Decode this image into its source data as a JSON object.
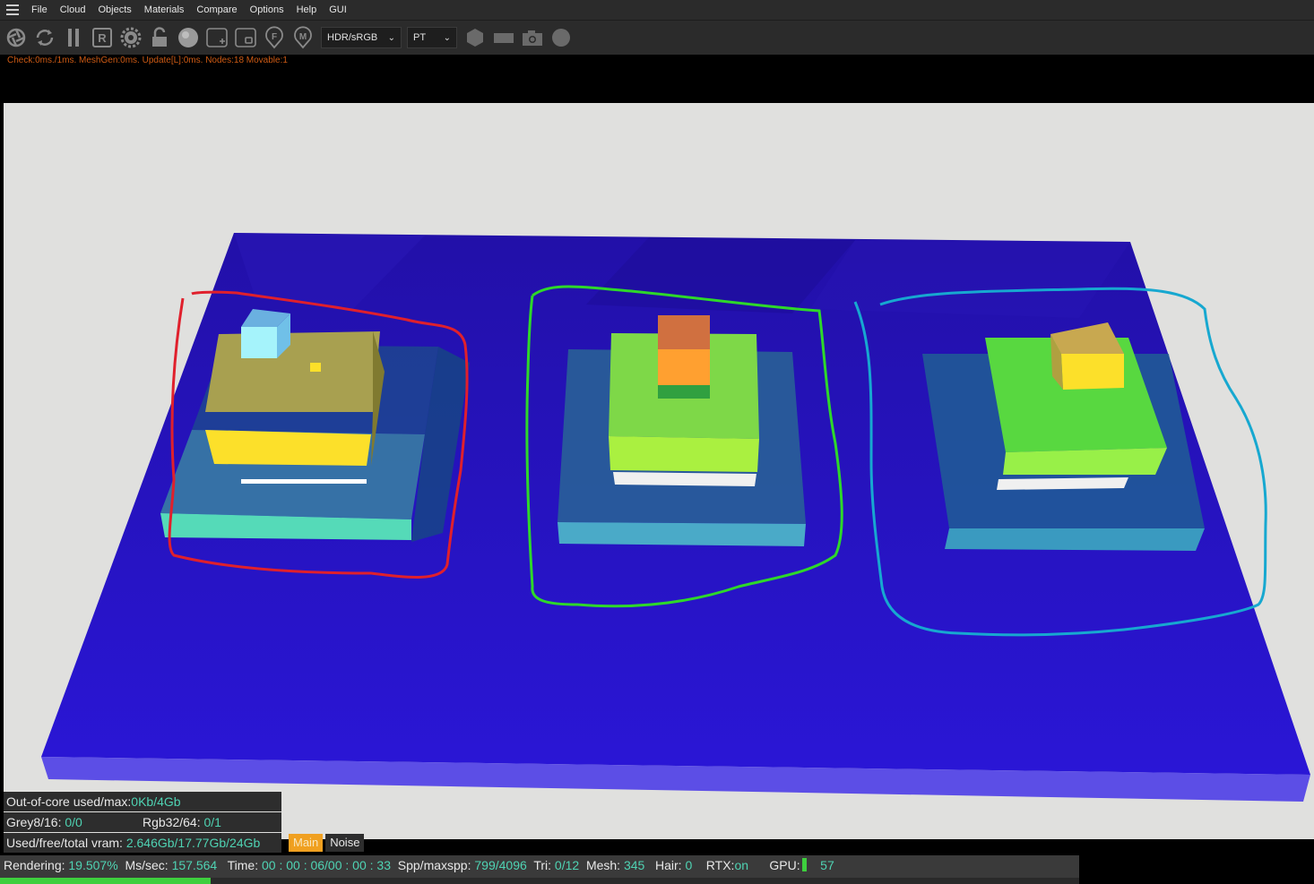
{
  "menu": [
    "File",
    "Cloud",
    "Objects",
    "Materials",
    "Compare",
    "Options",
    "Help",
    "GUI"
  ],
  "toolbar": {
    "tonemap_select": "HDR/sRGB",
    "kernel_select": "PT",
    "icons": [
      "aperture-icon",
      "refresh-icon",
      "pause-icon",
      "r-icon",
      "gear-icon",
      "lock-icon",
      "sphere-icon",
      "add-box-icon",
      "box-icon",
      "f-pin-icon",
      "m-pin-icon",
      "cube-icon",
      "rectangle-icon",
      "camera-icon",
      "circle-icon"
    ]
  },
  "stats_line": "Check:0ms./1ms. MeshGen:0ms. Update[L]:0ms. Nodes:18 Movable:1",
  "info": {
    "out_of_core_label": "Out-of-core used/max:",
    "out_of_core_value": "0Kb/4Gb",
    "grey_label": "Grey8/16:",
    "grey_value": "0/0",
    "rgb_label": "Rgb32/64:",
    "rgb_value": "0/1",
    "vram_label": "Used/free/total vram:",
    "vram_value": "2.646Gb/17.77Gb/24Gb"
  },
  "tabs": [
    "Main",
    "Noise"
  ],
  "status": {
    "rendering_label": "Rendering:",
    "rendering_value": "19.507%",
    "mssec_label": "Ms/sec:",
    "mssec_value": "157.564",
    "time_label": "Time:",
    "time_value": "00 : 00 : 06/00 : 00 : 33",
    "spp_label": "Spp/maxspp:",
    "spp_value": "799/4096",
    "tri_label": "Tri:",
    "tri_value": "0/12",
    "mesh_label": "Mesh:",
    "mesh_value": "345",
    "hair_label": "Hair:",
    "hair_value": "0",
    "rtx_label": "RTX:",
    "rtx_value": "on",
    "gpu_label": "GPU:",
    "gpu_value": "57"
  },
  "progress": 0.195,
  "colors": {
    "ground": "#2414c8",
    "annotation_red": "#e0202c",
    "annotation_green": "#2ed82a",
    "annotation_blue": "#17a8d0",
    "accent_orange": "#f0a020",
    "value_teal": "#4fd3b3"
  }
}
